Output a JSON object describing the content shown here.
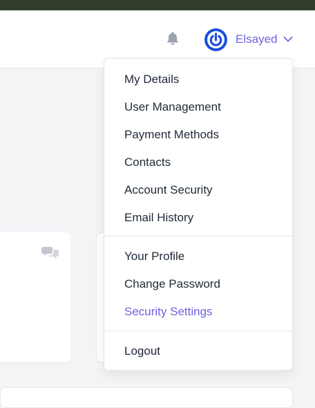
{
  "header": {
    "username": "Elsayed",
    "icons": {
      "notifications": "bell-icon",
      "avatar": "power-icon",
      "menu_toggle": "chevron-down-icon"
    }
  },
  "colors": {
    "accent": "#6c63e3",
    "avatar": "#1d4ed8",
    "top_bar": "#333d2b",
    "icon_gray": "#9ca3af"
  },
  "dropdown": {
    "account_items": [
      {
        "label": "My Details"
      },
      {
        "label": "User Management"
      },
      {
        "label": "Payment Methods"
      },
      {
        "label": "Contacts"
      },
      {
        "label": "Account Security"
      },
      {
        "label": "Email History"
      }
    ],
    "profile_items": [
      {
        "label": "Your Profile"
      },
      {
        "label": "Change Password"
      },
      {
        "label": "Security Settings",
        "active": true
      }
    ],
    "logout_label": "Logout"
  },
  "cards": {
    "chat_icon": "chat-bubbles-icon"
  }
}
